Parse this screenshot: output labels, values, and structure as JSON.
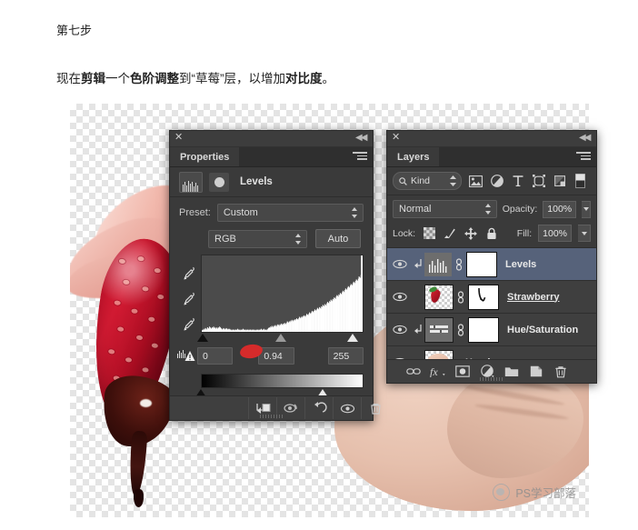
{
  "article": {
    "step_title": "第七步",
    "step_body_plain": "现在剪辑一个色阶调整到“草莓”层，以增加对比度。",
    "body_seg_1": "现在",
    "body_seg_2_bold": "剪辑",
    "body_seg_3": "一个",
    "body_seg_4_bold": "色阶调整",
    "body_seg_5": "到“草莓”层，以增加",
    "body_seg_6_bold": "对比度",
    "body_seg_7": "。"
  },
  "canvas": {
    "watermark": "PS学习部落"
  },
  "properties_panel": {
    "titlebar": {
      "close": "✕",
      "collapse": "◀◀"
    },
    "tab_label": "Properties",
    "adjustment_title": "Levels",
    "preset_label": "Preset:",
    "preset_value": "Custom",
    "channel_value": "RGB",
    "auto_button": "Auto",
    "input_black": "0",
    "input_gamma": "0.94",
    "input_white": "255",
    "footer_tools": [
      "clip-to-layer-icon",
      "view-previous-state-icon",
      "reset-adjustment-icon",
      "toggle-visibility-icon",
      "delete-adjustment-icon"
    ],
    "histogram": [
      2,
      3,
      2,
      4,
      3,
      5,
      4,
      3,
      6,
      5,
      4,
      7,
      6,
      5,
      4,
      6,
      5,
      7,
      6,
      5,
      4,
      6,
      5,
      4,
      6,
      5,
      7,
      6,
      5,
      4,
      3,
      4,
      5,
      4,
      3,
      4,
      5,
      4,
      3,
      4,
      3,
      4,
      3,
      2,
      3,
      2,
      3,
      2,
      3,
      2,
      3,
      2,
      3,
      4,
      3,
      2,
      3,
      2,
      3,
      2,
      3,
      4,
      3,
      2,
      3,
      2,
      3,
      2,
      3,
      2,
      3,
      2,
      3,
      2,
      3,
      2,
      3,
      2,
      3,
      2,
      2,
      3,
      2,
      3,
      2,
      3,
      2,
      3,
      4,
      3,
      2,
      3,
      4,
      3,
      2,
      3,
      2,
      3,
      4,
      5,
      6,
      5,
      7,
      6,
      8,
      7,
      6,
      8,
      7,
      9,
      8,
      7,
      9,
      10,
      9,
      8,
      10,
      9,
      11,
      10,
      9,
      11,
      10,
      12,
      11,
      10,
      12,
      14,
      13,
      12,
      14,
      13,
      15,
      14,
      16,
      15,
      14,
      16,
      15,
      17,
      16,
      18,
      17,
      16,
      18,
      20,
      19,
      18,
      20,
      19,
      21,
      20,
      22,
      21,
      20,
      22,
      24,
      23,
      22,
      24,
      26,
      25,
      24,
      26,
      28,
      27,
      26,
      28,
      30,
      29,
      28,
      30,
      32,
      31,
      30,
      33,
      32,
      31,
      34,
      33,
      36,
      35,
      34,
      37,
      36,
      35,
      38,
      40,
      39,
      38,
      41,
      40,
      43,
      42,
      41,
      44,
      43,
      46,
      45,
      44,
      47,
      49,
      48,
      47,
      50,
      49,
      52,
      51,
      50,
      53,
      55,
      54,
      53,
      56,
      58,
      57,
      56,
      59,
      61,
      60,
      59,
      62,
      64,
      63,
      62,
      65,
      67,
      66,
      65,
      68,
      70,
      69,
      68,
      71,
      74,
      73,
      72,
      76,
      80,
      98
    ],
    "dropper_icons": [
      "set-black-point-eyedropper",
      "set-gray-point-eyedropper",
      "set-white-point-eyedropper"
    ],
    "warning_icon": "clipping-warning-icon"
  },
  "layers_panel": {
    "titlebar": {
      "close": "✕",
      "collapse": "◀◀"
    },
    "tab_label": "Layers",
    "filter_kind_label": "Kind",
    "filter_icons": [
      "pixel-layer-filter-icon",
      "adjustment-layer-filter-icon",
      "type-layer-filter-icon",
      "shape-layer-filter-icon",
      "smart-object-filter-icon",
      "filter-toggle-switch-icon"
    ],
    "blend_mode": "Normal",
    "opacity_label": "Opacity:",
    "opacity_value": "100%",
    "lock_label": "Lock:",
    "lock_icons": [
      "lock-transparent-pixels-icon",
      "lock-image-pixels-icon",
      "lock-position-icon",
      "lock-all-icon"
    ],
    "fill_label": "Fill:",
    "fill_value": "100%",
    "layers": [
      {
        "name": "Levels",
        "selected": true,
        "clipped": true,
        "has_mask": true,
        "thumb_kind": "adjustment-levels",
        "underline": false
      },
      {
        "name": "Strawberry",
        "selected": false,
        "clipped": false,
        "has_mask": true,
        "thumb_kind": "strawberry-photo",
        "underline": true
      },
      {
        "name": "Hue/Saturation",
        "selected": false,
        "clipped": true,
        "has_mask": true,
        "thumb_kind": "adjustment-huesat",
        "underline": false
      },
      {
        "name": "Hand",
        "selected": false,
        "clipped": false,
        "has_mask": false,
        "thumb_kind": "hand-photo",
        "underline": true
      }
    ],
    "footer_icons": [
      "link-layers-icon",
      "layer-style-fx-icon",
      "add-layer-mask-icon",
      "new-adjustment-layer-icon",
      "new-group-icon",
      "new-layer-icon",
      "delete-layer-icon"
    ]
  },
  "colors": {
    "panel_bg": "#3a3a3a",
    "panel_tab_bg": "#2f2f2f",
    "row_bg": "#3f3f3f",
    "row_selected": "#56627a",
    "text": "#e2e2e2",
    "accent_red": "#d62b2b",
    "page_bg": "#ffffff"
  }
}
